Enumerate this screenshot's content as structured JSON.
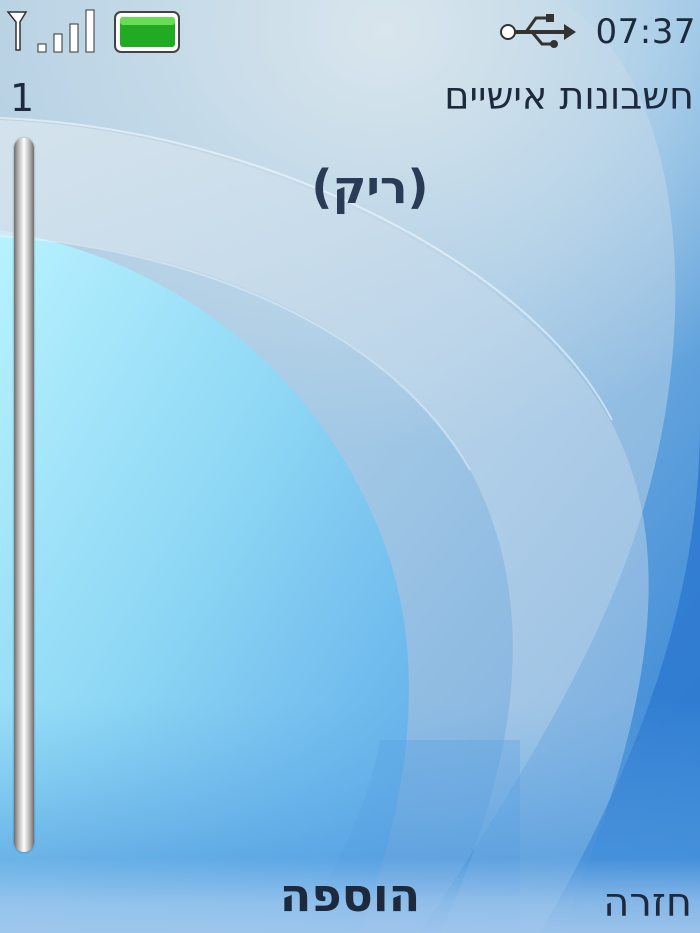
{
  "status_bar": {
    "time": "07:37",
    "signal_icon": "signal-strength-icon",
    "battery_icon": "battery-full-icon",
    "usb_icon": "usb-connected-icon",
    "battery_color": "#22aa22"
  },
  "header": {
    "title": "חשבונות אישיים",
    "count": "1"
  },
  "main": {
    "empty_label": "(ריק)"
  },
  "softkeys": {
    "center": "הוספה",
    "right": "חזרה"
  }
}
